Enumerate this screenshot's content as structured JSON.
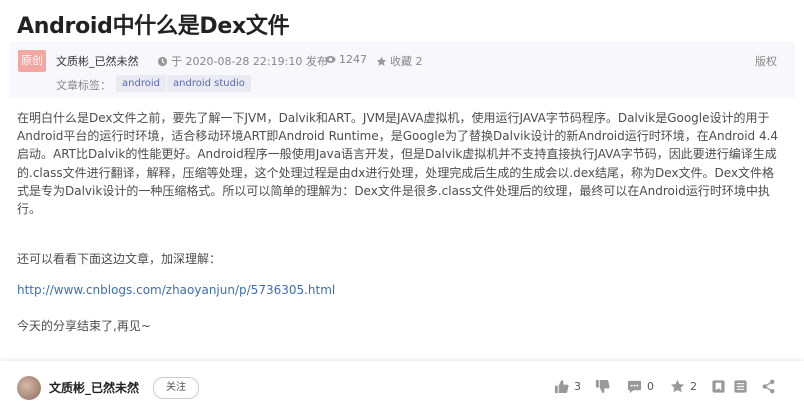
{
  "article": {
    "title": "Android中什么是Dex文件",
    "original_badge": "原创",
    "author": "文质彬_已然未然",
    "date": "于 2020-08-28 22:19:10 发布",
    "views": "1247",
    "favorites": "收藏 2",
    "copyright": "版权",
    "tags_label": "文章标签：",
    "tags": [
      "android",
      "android studio"
    ]
  },
  "content": {
    "paragraph1": "在明白什么是Dex文件之前，要先了解一下JVM，Dalvik和ART。JVM是JAVA虚拟机，使用运行JAVA字节码程序。Dalvik是Google设计的用于Android平台的运行时环境，适合移动环境ART即Android Runtime，是Google为了替换Dalvik设计的新Android运行时环境，在Android 4.4启动。ART比Dalvik的性能更好。Android程序一般使用Java语言开发，但是Dalvik虚拟机并不支持直接执行JAVA字节码，因此要进行编译生成的.class文件进行翻译，解释，压缩等处理，这个处理过程是由dx进行处理，处理完成后生成的生成会以.dex结尾，称为Dex文件。Dex文件格式是专为Dalvik设计的一种压缩格式。所以可以简单的理解为：Dex文件是很多.class文件处理后的纹理，最终可以在Android运行时环境中执行。",
    "paragraph2": "还可以看看下面这边文章，加深理解：",
    "link": "http://www.cnblogs.com/zhaoyanjun/p/5736305.html",
    "paragraph3": "今天的分享结束了,再见~"
  },
  "toolbar": {
    "author": "文质彬_已然未然",
    "follow_label": "关注",
    "like_count": "3",
    "dislike_count": "",
    "comment_count": "0",
    "star_count": "2",
    "icons": [
      "thumbs-up-icon",
      "thumbs-down-icon",
      "comment-icon",
      "star-icon",
      "bookmark-icon",
      "list-icon",
      "share-icon"
    ]
  }
}
